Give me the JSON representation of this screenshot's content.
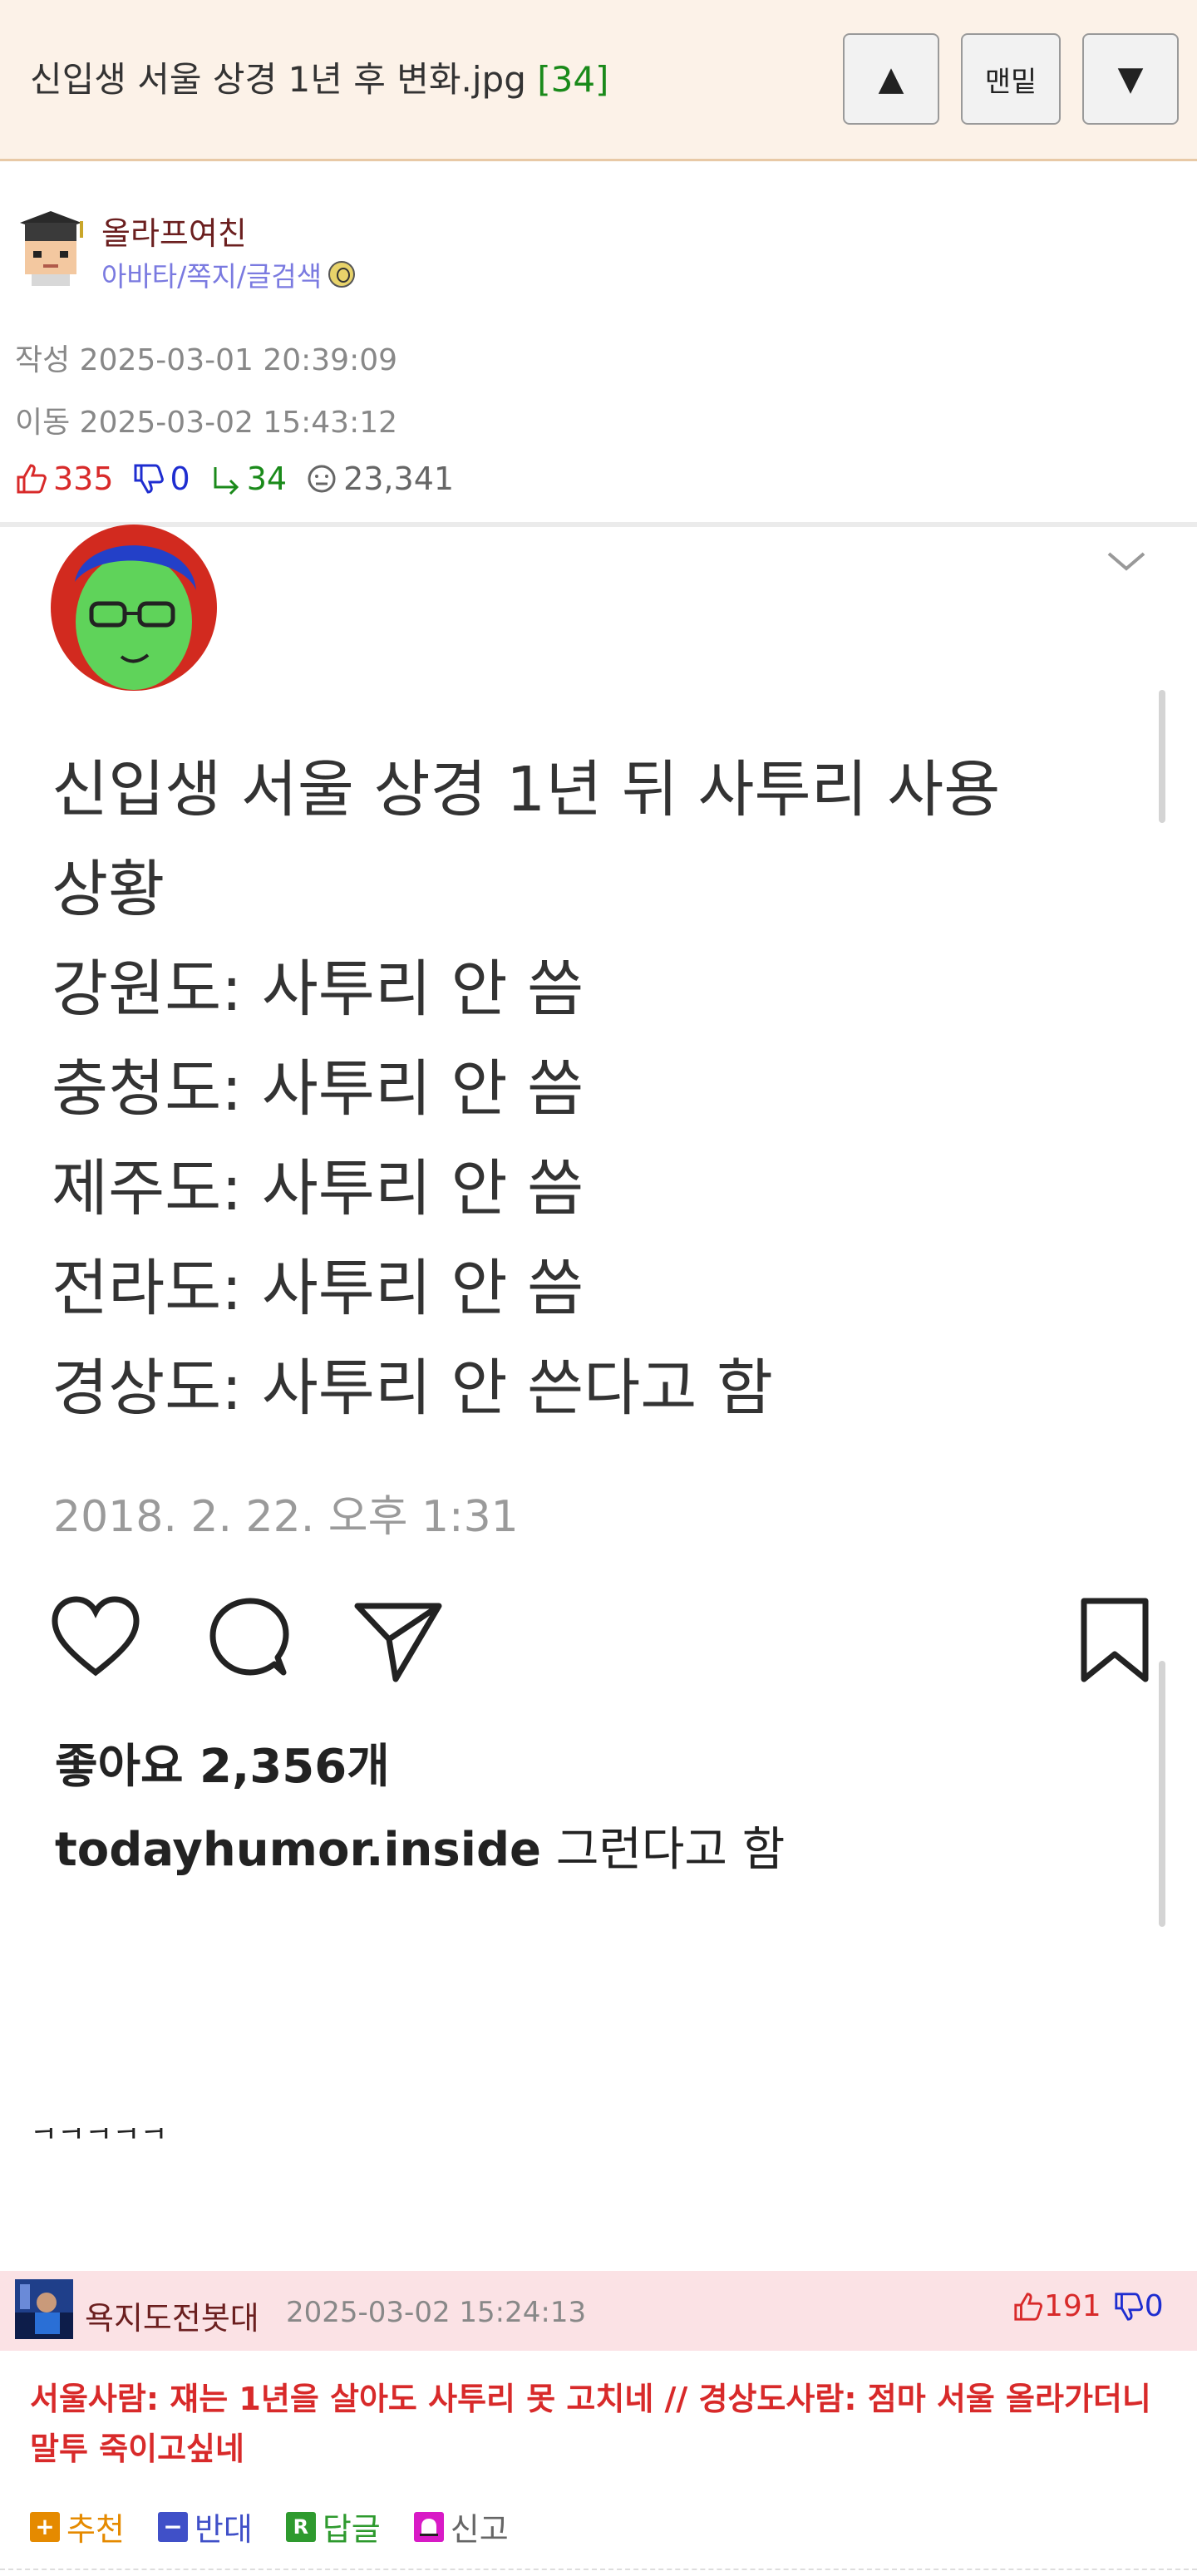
{
  "header": {
    "title": "신입생 서울 상경 1년 후 변화.jpg",
    "comment_count": "[34]",
    "up_label": "▲",
    "bottom_label": "맨밑",
    "down_label": "▼"
  },
  "author": {
    "name": "올라프여친",
    "links": "아바타/쪽지/글검색"
  },
  "meta": {
    "written": "작성 2025-03-01 20:39:09",
    "moved": "이동 2025-03-02 15:43:12"
  },
  "stats": {
    "upvotes": "335",
    "downvotes": "0",
    "replies": "34",
    "views": "23,341"
  },
  "embed": {
    "lines": [
      "신입생 서울 상경 1년 뒤 사투리 사용",
      "상황",
      "강원도: 사투리 안 씀",
      "충청도: 사투리 안 씀",
      "제주도: 사투리 안 씀",
      "전라도: 사투리 안 씀",
      "경상도: 사투리 안 쓴다고 함"
    ],
    "date": "2018. 2. 22. 오후 1:31",
    "likes": "좋아요 2,356개",
    "caption_user": "todayhumor.inside",
    "caption_text": " 그런다고 함"
  },
  "body_text": "ㅋㅋㅋㅋㅋ",
  "comment": {
    "name": "욕지도전봇대",
    "time": "2025-03-02 15:24:13",
    "upvotes": "191",
    "downvotes": "0",
    "text": "서울사람: 쟤는 1년을 살아도 사투리 못 고치네 // 경상도사람: 점마 서울 올라가더니 말투 죽이고싶네",
    "actions": {
      "recommend": "추천",
      "oppose": "반대",
      "reply": "답글",
      "report": "신고"
    }
  },
  "colors": {
    "header_bg": "#fcf2e8",
    "upvote": "#d82a2a",
    "downvote": "#1e2dd0",
    "reply": "#1a8a1a",
    "comment_bg": "#fbe2e5"
  },
  "icons": [
    "thumb-up-icon",
    "thumb-down-icon",
    "reply-arrow-icon",
    "view-face-icon",
    "heart-icon",
    "comment-bubble-icon",
    "send-icon",
    "bookmark-icon",
    "chevron-down-icon"
  ]
}
